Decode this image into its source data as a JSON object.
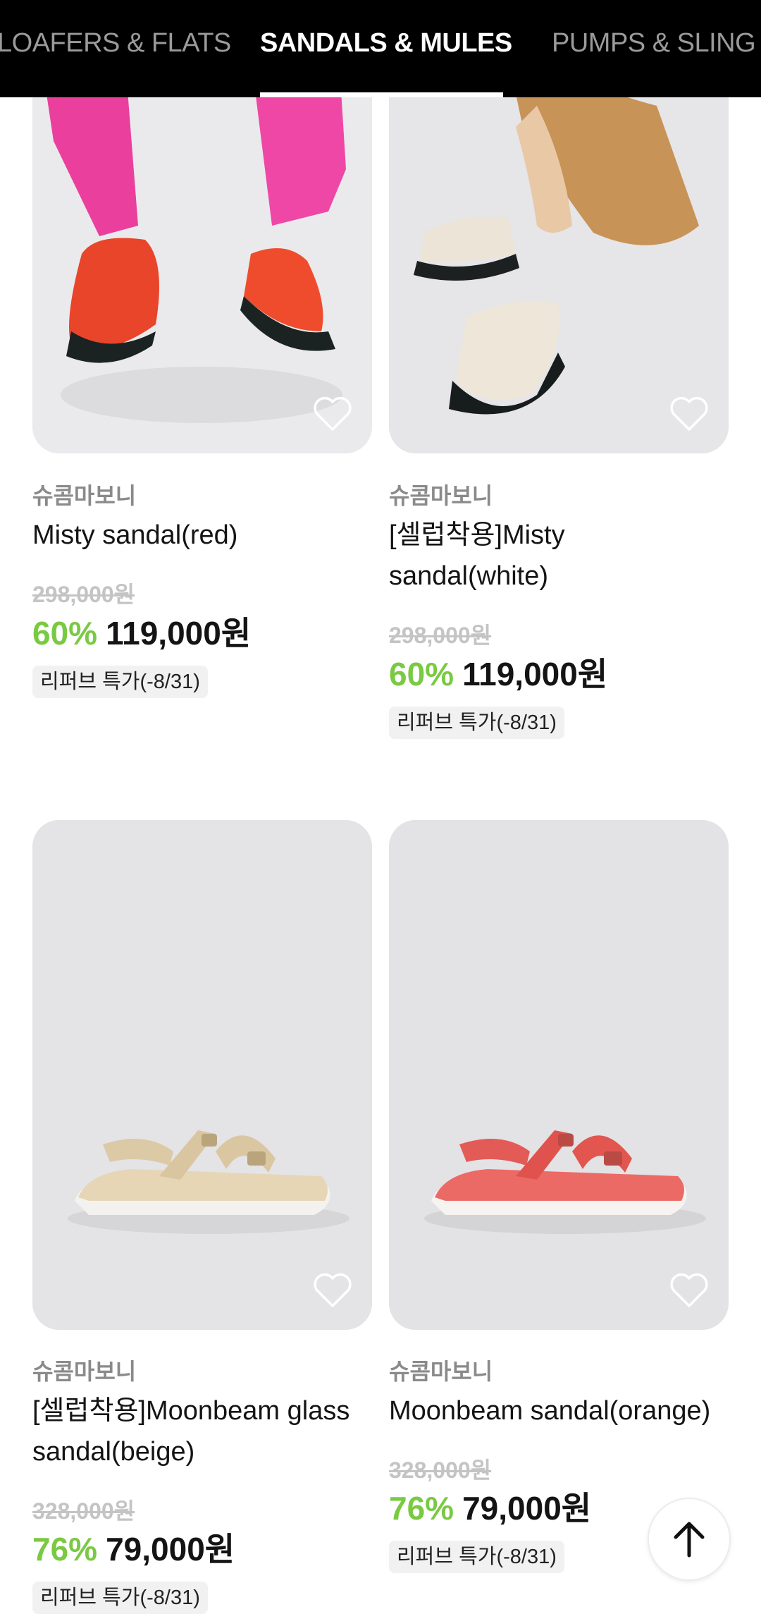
{
  "categories": [
    {
      "label": "LOAFERS & FLATS",
      "active": false
    },
    {
      "label": "SANDALS & MULES",
      "active": true
    },
    {
      "label": "PUMPS & SLING B",
      "active": false
    }
  ],
  "products": [
    {
      "brand": "슈콤마보니",
      "name": "Misty sandal(red)",
      "original_price": "298,000원",
      "discount": "60%",
      "price": "119,000원",
      "badge": "리퍼브 특가(-8/31)",
      "image": "sandal-red-photo"
    },
    {
      "brand": "슈콤마보니",
      "name": "[셀럽착용]Misty sandal(white)",
      "original_price": "298,000원",
      "discount": "60%",
      "price": "119,000원",
      "badge": "리퍼브 특가(-8/31)",
      "image": "sandal-white-photo"
    },
    {
      "brand": "슈콤마보니",
      "name": "[셀럽착용]Moonbeam glass sandal(beige)",
      "original_price": "328,000원",
      "discount": "76%",
      "price": "79,000원",
      "badge": "리퍼브 특가(-8/31)",
      "image": "sandal-beige-photo"
    },
    {
      "brand": "슈콤마보니",
      "name": "Moonbeam sandal(orange)",
      "original_price": "328,000원",
      "discount": "76%",
      "price": "79,000원",
      "badge": "리퍼브 특가(-8/31)",
      "image": "sandal-orange-photo"
    }
  ],
  "colors": {
    "discount": "#7ac943",
    "header_bg": "#000000",
    "image_bg": "#e7e6e8"
  },
  "icons": {
    "wishlist": "heart-outline-icon",
    "scroll_top": "arrow-up-icon"
  }
}
